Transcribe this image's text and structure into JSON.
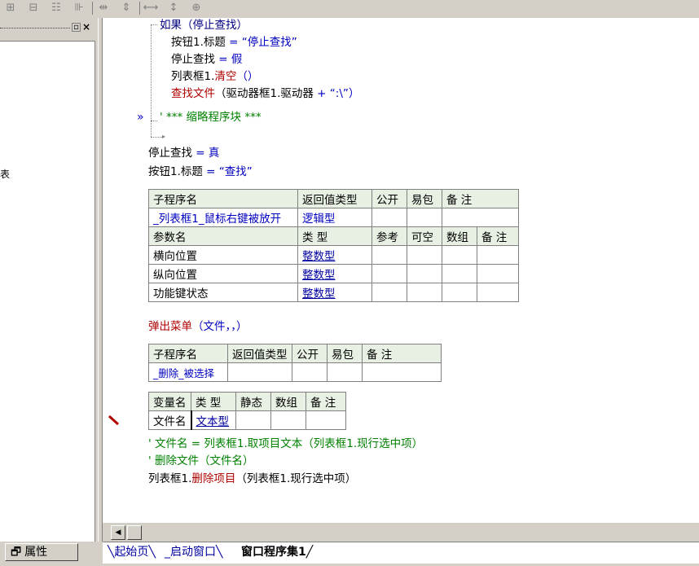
{
  "toolbar": {
    "icons": [
      "table-col-left-icon",
      "table-row-icon",
      "table-merge-icon",
      "table-split-icon",
      "col-width-icon",
      "row-height-icon",
      "width-equal-icon",
      "height-equal-icon",
      "distribute-icon"
    ]
  },
  "left_panel": {
    "close_glyph": "×",
    "restore_glyph": "▫",
    "partial_label": "表"
  },
  "code": {
    "l1": "如果（停止查找）",
    "l2a": "按钮1.标题",
    "l2b": " = ",
    "l2c": "“停止查找”",
    "l3a": "停止查找",
    "l3b": " = ",
    "l3c": "假",
    "l4a": "列表框1.",
    "l4b": "清空",
    "l4c": "（）",
    "l5a": "查找文件",
    "l5b": "（驱动器框1.驱动器",
    "l5c": " + ",
    "l5d": "“:\\”）",
    "l6": "' *** 缩略程序块 ***",
    "l7a": "停止查找",
    "l7b": " = ",
    "l7c": "真",
    "l8a": "按钮1.标题",
    "l8b": " = ",
    "l8c": "“查找”",
    "popup_a": "弹出菜单",
    "popup_b": "（文件，，）",
    "c1": "' 文件名 = 列表框1.取项目文本（列表框1.现行选中项）",
    "c2": "' 删除文件（文件名）",
    "last_a": "列表框1.",
    "last_b": "删除项目",
    "last_c": "（列表框1.现行选中项）"
  },
  "sub1": {
    "headers": [
      "子程序名",
      "返回值类型",
      "公开",
      "易包",
      "备 注"
    ],
    "name": "_列表框1_鼠标右键被放开",
    "return_type": "逻辑型",
    "param_headers": [
      "参数名",
      "类 型",
      "参考",
      "可空",
      "数组",
      "备 注"
    ],
    "params": [
      {
        "name": "横向位置",
        "type": "整数型"
      },
      {
        "name": "纵向位置",
        "type": "整数型"
      },
      {
        "name": "功能键状态",
        "type": "整数型"
      }
    ]
  },
  "sub2": {
    "headers": [
      "子程序名",
      "返回值类型",
      "公开",
      "易包",
      "备 注"
    ],
    "name": "_删除_被选择"
  },
  "vars": {
    "headers": [
      "变量名",
      "类 型",
      "静态",
      "数组",
      "备 注"
    ],
    "name": "文件名",
    "type": "文本型"
  },
  "bottom": {
    "properties_label": "属性",
    "tabs": [
      "起始页",
      "_启动窗口",
      "窗口程序集1"
    ],
    "active_tab": "窗口程序集1"
  },
  "colors": {
    "blue": "#0000c0",
    "red": "#b00000",
    "green": "#008000",
    "table_header": "#e8f0e4"
  }
}
